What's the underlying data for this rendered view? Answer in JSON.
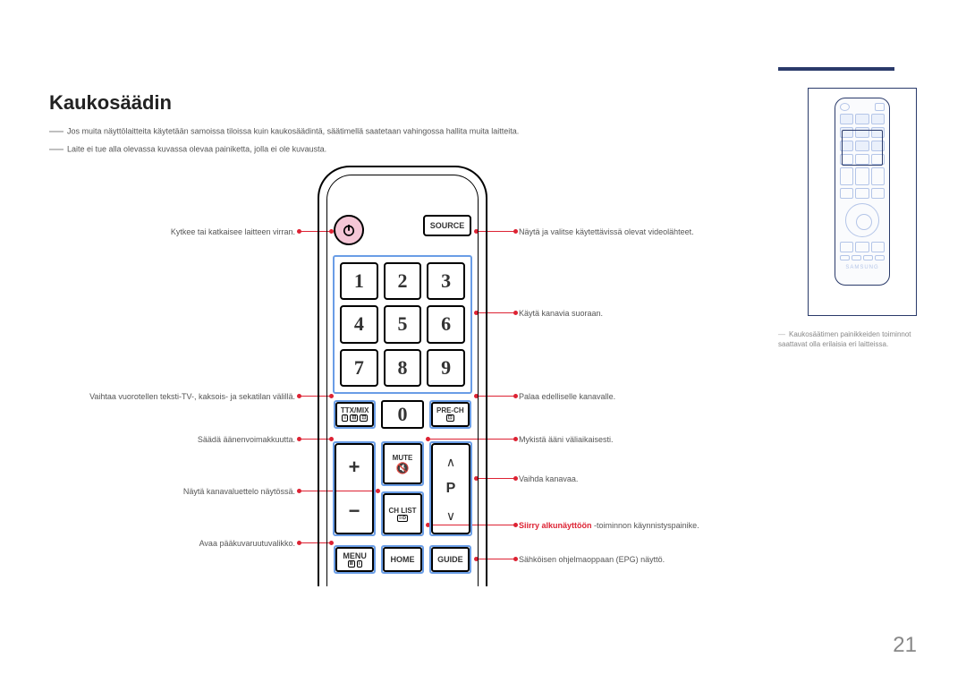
{
  "title": "Kaukosäädin",
  "notes": {
    "n1": "Jos muita näyttölaitteita käytetään samoissa tiloissa kuin kaukosäädintä, säätimellä saatetaan vahingossa hallita muita laitteita.",
    "n2": "Laite ei tue alla olevassa kuvassa olevaa painiketta, jolla ei ole kuvausta."
  },
  "page_number": "21",
  "remote": {
    "source": "SOURCE",
    "numbers": [
      "1",
      "2",
      "3",
      "4",
      "5",
      "6",
      "7",
      "8",
      "9"
    ],
    "zero": "0",
    "ttxmix": "TTX/MIX",
    "prech": "PRE-CH",
    "mute": "MUTE",
    "chlist": "CH LIST",
    "p": "P",
    "menu": "MENU",
    "home": "HOME",
    "guide": "GUIDE",
    "plus": "+",
    "minus": "−",
    "up": "∧",
    "down": "∨"
  },
  "callouts": {
    "left": {
      "power": "Kytkee tai katkaisee laitteen virran.",
      "ttx": "Vaihtaa vuorotellen teksti-TV-, kaksois- ja sekatilan välillä.",
      "vol": "Säädä äänenvoimakkuutta.",
      "chlist": "Näytä kanavaluettelo näytössä.",
      "menu": "Avaa pääkuvaruutuvalikko."
    },
    "right": {
      "source": "Näytä ja valitse käytettävissä olevat videolähteet.",
      "numpad": "Käytä kanavia suoraan.",
      "prech": "Palaa edelliselle kanavalle.",
      "mute": "Mykistä ääni väliaikaisesti.",
      "chan": "Vaihda kanavaa.",
      "home_pre": "Siirry alkunäyttöön",
      "home_post": " -toiminnon käynnistyspainike.",
      "guide": "Sähköisen ohjelmaoppaan (EPG) näyttö."
    }
  },
  "mini_note_dash": "―",
  "mini_note": "Kaukosäätimen painikkeiden toiminnot saattavat olla erilaisia eri laitteissa.",
  "mini_brand": "SAMSUNG"
}
